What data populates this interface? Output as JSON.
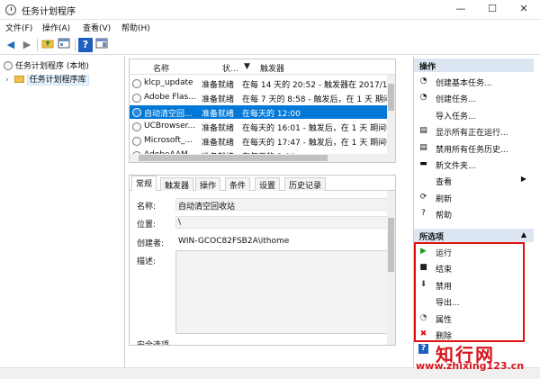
{
  "window": {
    "title": "任务计划程序",
    "minimize": "—",
    "maximize": "☐",
    "close": "✕"
  },
  "menu": [
    "文件(F)",
    "操作(A)",
    "查看(V)",
    "帮助(H)"
  ],
  "toolbar": {
    "back": "◀",
    "forward": "▶",
    "help": "?"
  },
  "tree": {
    "root": "任务计划程序 (本地)",
    "library": "任务计划程序库",
    "expander": "›"
  },
  "task_list": {
    "columns": [
      "名称",
      "状...",
      "触发器"
    ],
    "rows": [
      {
        "name": "klcp_update",
        "status": "准备就绪",
        "trigger": "在每 14 天的 20:52 - 触发器在 2017/1/29"
      },
      {
        "name": "Adobe Flas...",
        "status": "准备就绪",
        "trigger": "在每 7 天的 8:58 - 触发后，在 1 天 期间每"
      },
      {
        "name": "自动清空回...",
        "status": "准备就绪",
        "trigger": "在每天的 12:00"
      },
      {
        "name": "UCBrowser...",
        "status": "准备就绪",
        "trigger": "在每天的 16:01 - 触发后，在 1 天 期间每隔"
      },
      {
        "name": "Microsoft_...",
        "status": "准备就绪",
        "trigger": "在每天的 17:47 - 触发后，在 1 天 期间每隔"
      },
      {
        "name": "AdobeAAM...",
        "status": "准备就绪",
        "trigger": "在每天的 2:00"
      }
    ],
    "selected_index": 2
  },
  "details": {
    "tabs": [
      "常规",
      "触发器",
      "操作",
      "条件",
      "设置",
      "历史记录"
    ],
    "active_tab": "常规",
    "name_label": "名称:",
    "name_value": "自动清空回收站",
    "location_label": "位置:",
    "location_value": "\\",
    "author_label": "创建者:",
    "author_value": "WIN-GCOC82FSB2A\\ithome",
    "description_label": "描述:",
    "security_label": "安全选项"
  },
  "actions": {
    "header": "操作",
    "library_items": [
      {
        "icon": "create-basic-task-icon",
        "glyph": "◔",
        "label": "创建基本任务..."
      },
      {
        "icon": "create-task-icon",
        "glyph": "◔",
        "label": "创建任务..."
      },
      {
        "icon": "import-icon",
        "glyph": "",
        "label": "导入任务..."
      },
      {
        "icon": "running-tasks-icon",
        "glyph": "▤",
        "label": "显示所有正在运行..."
      },
      {
        "icon": "history-icon",
        "glyph": "▤",
        "label": "禁用所有任务历史..."
      },
      {
        "icon": "new-folder-icon",
        "glyph": "▬",
        "label": "新文件夹..."
      },
      {
        "icon": "view-icon",
        "glyph": "",
        "label": "查看"
      },
      {
        "icon": "refresh-icon",
        "glyph": "⟳",
        "label": "刷新"
      },
      {
        "icon": "help-icon",
        "glyph": "?",
        "label": "帮助"
      }
    ],
    "submenu_arrow": "▶",
    "selected_header": "所选项",
    "selected_caret": "▲",
    "selected_items": [
      {
        "icon": "run-icon",
        "glyph": "▶",
        "color": "#1a9e1a",
        "label": "运行"
      },
      {
        "icon": "end-icon",
        "glyph": "■",
        "color": "#222222",
        "label": "结束"
      },
      {
        "icon": "disable-icon",
        "glyph": "⬇",
        "color": "#444444",
        "label": "禁用"
      },
      {
        "icon": "export-icon",
        "glyph": "",
        "color": "#444444",
        "label": "导出..."
      },
      {
        "icon": "properties-icon",
        "glyph": "◔",
        "color": "#555555",
        "label": "属性"
      },
      {
        "icon": "delete-icon",
        "glyph": "✖",
        "color": "#e01010",
        "label": "删除"
      }
    ],
    "bottom_help": "?"
  },
  "colors": {
    "selection": "#0078d7",
    "highlight_box": "#e01010",
    "section_header": "#dce6f2"
  },
  "watermark": {
    "text": "知行网",
    "url": "www.zhixing123.cn"
  }
}
